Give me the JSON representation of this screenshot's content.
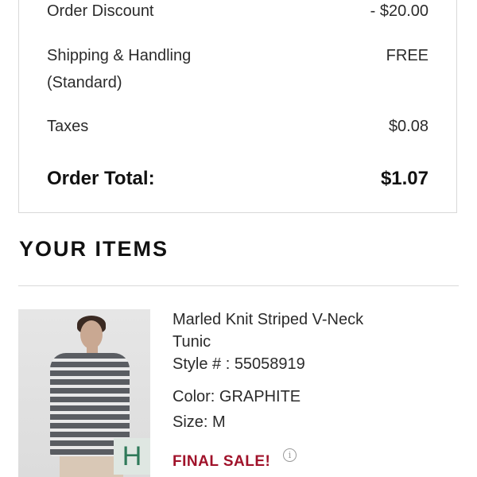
{
  "summary": {
    "order_discount_label": "Order Discount",
    "order_discount_value": "- $20.00",
    "shipping_label_line1": "Shipping & Handling",
    "shipping_label_line2": "(Standard)",
    "shipping_value": "FREE",
    "taxes_label": "Taxes",
    "taxes_value": "$0.08",
    "total_label": "Order Total:",
    "total_value": "$1.07"
  },
  "items_section": {
    "title": "YOUR ITEMS"
  },
  "item": {
    "name_line1": "Marled Knit Striped V-Neck",
    "name_line2": "Tunic",
    "style": "Style # : 55058919",
    "color": "Color: GRAPHITE",
    "size": "Size: M",
    "final_sale": "FINAL SALE!",
    "badge_letter": "H",
    "info_icon": "info-icon",
    "image_icon": "product-photo"
  },
  "colors": {
    "final_sale": "#a0122a",
    "badge_bg": "#dfe7e2",
    "badge_text": "#2f7a5a",
    "divider": "#d9d9d9"
  }
}
